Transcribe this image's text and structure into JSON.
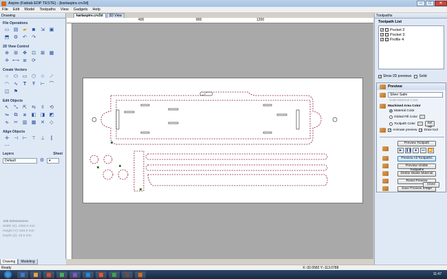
{
  "window": {
    "title": "Aspire (Fablab EDP TESTE) - [kartaspire.crv3d]"
  },
  "menu": [
    "File",
    "Edit",
    "Model",
    "Toolpaths",
    "View",
    "Gadgets",
    "Help"
  ],
  "left_panel": {
    "header": "Drawing",
    "sections": {
      "file_operations": "File Operations",
      "view_control": "2D View Control",
      "create_vectors": "Create Vectors",
      "edit_objects": "Edit Objects",
      "align_objects": "Align Objects"
    },
    "layers_label": "Layers",
    "sheet_label": "Sheet",
    "layer_value": "Default",
    "job_dimensions": {
      "title": "Job Dimensions",
      "width": "Width  (X): 1050.0 mm",
      "height": "Height (Y): 640.0 mm",
      "depth": "Depth  (Z): 15.0 mm"
    },
    "tabs": [
      "Drawing",
      "Modeling"
    ]
  },
  "document": {
    "tabs": [
      "kartaspire.crv3d",
      "3D View"
    ],
    "ruler_labels": [
      "400",
      "800",
      "1200"
    ]
  },
  "right_panel": {
    "header": "Toolpaths",
    "list_title": "Toolpath List",
    "toolpaths": [
      "Pocket 2",
      "Pocket 3",
      "Profile 4"
    ],
    "show_2d_previews": "Show 2D previews",
    "solid": "Solid",
    "preview": {
      "title": "Preview",
      "material": "Silver Satin",
      "solid_material_color": "Solid Material Color",
      "machined_area_color": "Machined Area Color",
      "material_color": "Material Color",
      "global_fill_color": "Global Fill Color",
      "toolpath_color": "Toolpath Color",
      "set_all": "Set All",
      "animate_preview": "Animate preview",
      "draw_tool": "Draw tool",
      "preview_toolpath": "Preview Toolpath",
      "preview_all": "Preview All Toolpaths",
      "preview_visible": "Preview Visible Toolpaths",
      "delete_waste": "Delete Waste Material",
      "reset_preview": "Reset Preview",
      "save_preview_image": "Save Preview Image",
      "close": "Close"
    }
  },
  "status": {
    "ready": "Ready",
    "coords": "X:-32.0582 Y:-113.0788"
  },
  "taskbar": {
    "clock": "11:47",
    "apps": [
      "#3a7bd5",
      "#e8a33b",
      "#d94f2b",
      "#4caf50",
      "#7e57c2",
      "#1e88e5",
      "#f4511e",
      "#43a047",
      "#6d4c41",
      "#d46a1f"
    ]
  },
  "colors": {
    "toolpath": "#8b1a3a",
    "accent": "#1f4fa0"
  }
}
